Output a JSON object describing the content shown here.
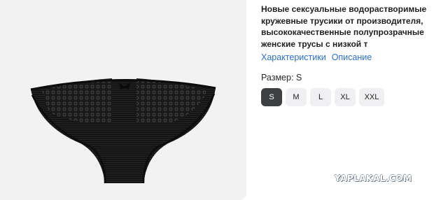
{
  "product": {
    "title_lines": [
      "Новые сексуальные водорастворимые",
      "кружевные трусики от производителя,",
      "высококачественные полупрозрачные",
      "женские трусы с низкой т"
    ],
    "image_icon": "lace-panties-product-photo"
  },
  "tabs": [
    "Характеристики",
    "Описание"
  ],
  "size": {
    "label": "Размер: S",
    "options": [
      "S",
      "M",
      "L",
      "XL",
      "XXL"
    ],
    "selected": "S"
  },
  "watermark": "YAPLAKAL.COM",
  "colors": {
    "link": "#2a6fd6",
    "selected_bg": "#3d3f43",
    "option_bg": "#f0f0f2",
    "image_bg": "#f2f2f2"
  }
}
